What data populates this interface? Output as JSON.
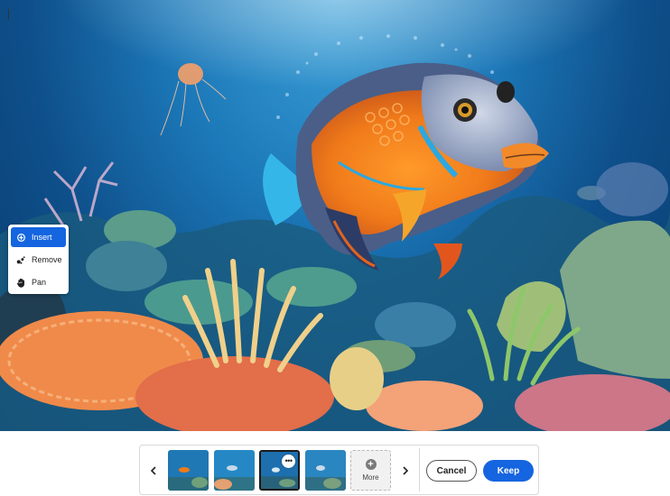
{
  "tool_menu": {
    "items": [
      {
        "label": "Insert",
        "icon": "insert-brush-icon",
        "active": true
      },
      {
        "label": "Remove",
        "icon": "remove-brush-icon",
        "active": false
      },
      {
        "label": "Pan",
        "icon": "hand-icon",
        "active": false
      }
    ]
  },
  "variations": {
    "prev_icon": "chevron-left-icon",
    "next_icon": "chevron-right-icon",
    "thumbnails": [
      {
        "selected": false
      },
      {
        "selected": false
      },
      {
        "selected": true,
        "more_options": "•••"
      },
      {
        "selected": false
      }
    ],
    "more": {
      "label": "More",
      "icon": "plus-circle-icon"
    }
  },
  "actions": {
    "cancel_label": "Cancel",
    "keep_label": "Keep"
  },
  "colors": {
    "accent": "#1565e0",
    "ocean_deep": "#0a3a6c",
    "ocean_light": "#3aa0d8",
    "fish_orange": "#f07a1a"
  }
}
